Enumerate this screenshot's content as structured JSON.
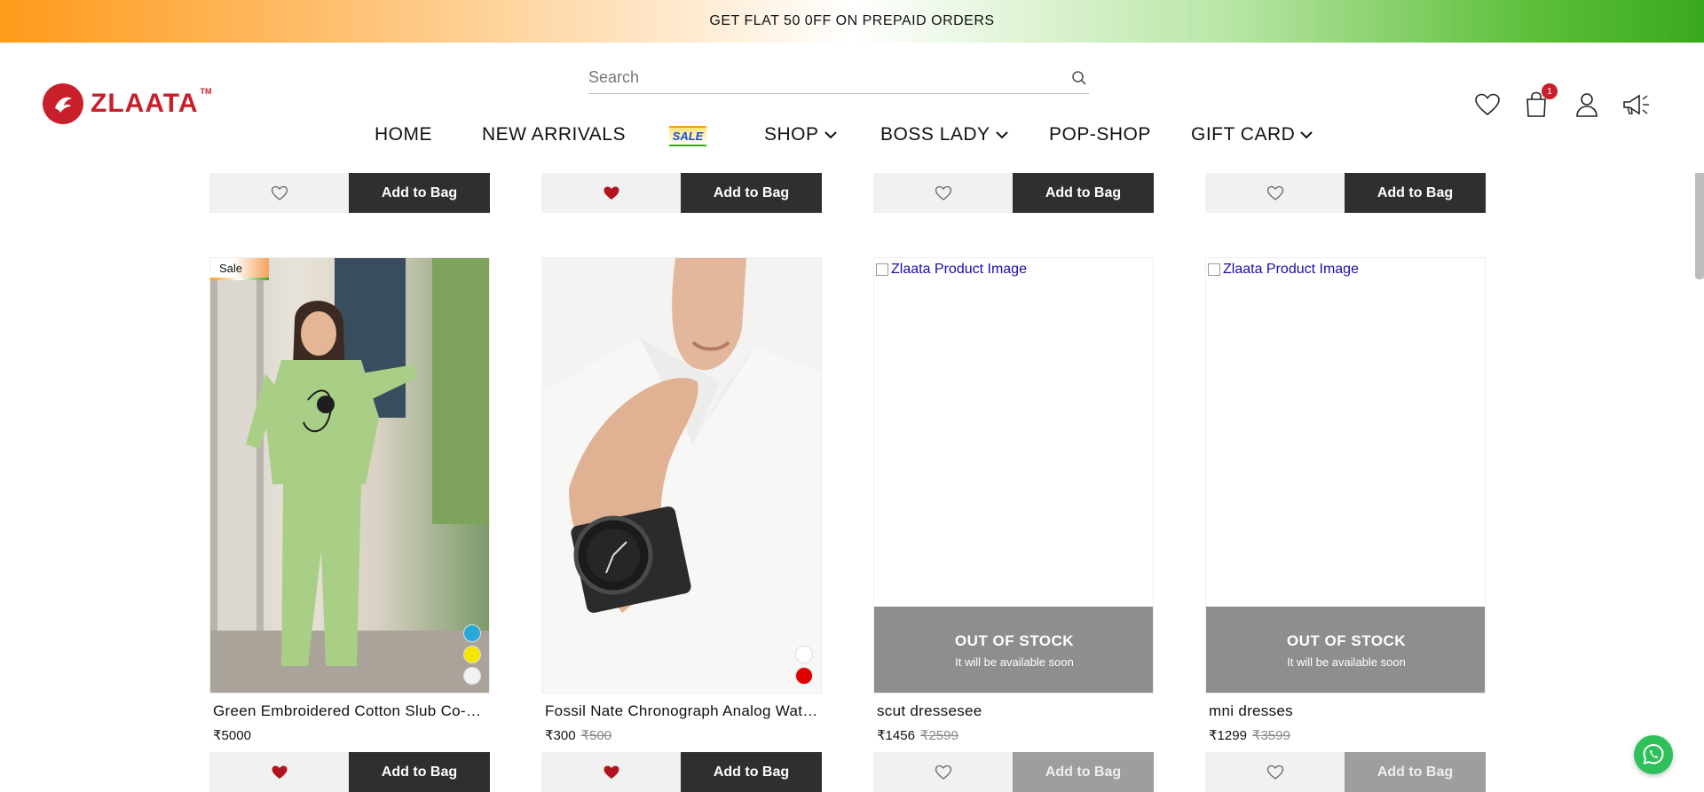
{
  "promo": {
    "text": "GET FLAT 50 0FF ON PREPAID ORDERS"
  },
  "brand": {
    "name": "ZLAATA",
    "tm": "TM",
    "color": "#c8202a"
  },
  "search": {
    "placeholder": "Search"
  },
  "nav": {
    "items": [
      {
        "label": "HOME"
      },
      {
        "label": "NEW ARRIVALS"
      },
      {
        "label": "SALE"
      },
      {
        "label": "SHOP",
        "dropdown": true
      },
      {
        "label": "BOSS LADY",
        "dropdown": true
      },
      {
        "label": "POP-SHOP"
      },
      {
        "label": "GIFT CARD",
        "dropdown": true
      }
    ]
  },
  "header_icons": {
    "cart_count": "1"
  },
  "top_row": {
    "add_to_bag": "Add to Bag",
    "wishlisted": [
      false,
      true,
      false,
      false
    ]
  },
  "products": [
    {
      "name": "Green Embroidered Cotton Slub Co-ord Set",
      "price": "₹5000",
      "old_price": "",
      "sale_tag": "Sale",
      "wishlisted": true,
      "out_of_stock": false,
      "swatches": [
        "#2aa8d8",
        "#f5e600",
        "#f1f1f1"
      ],
      "add_to_bag": "Add to Bag"
    },
    {
      "name": "Fossil Nate Chronograph Analog Watch",
      "price": "₹300",
      "old_price": "₹500",
      "sale_tag": "",
      "wishlisted": true,
      "out_of_stock": false,
      "swatches": [
        "#ffffff",
        "#e00000"
      ],
      "add_to_bag": "Add to Bag"
    },
    {
      "name": "scut dressesee",
      "price": "₹1456",
      "old_price": "₹2599",
      "sale_tag": "",
      "wishlisted": false,
      "out_of_stock": true,
      "image_alt": "Zlaata Product Image",
      "oos_title": "OUT OF STOCK",
      "oos_sub": "It will be available soon",
      "add_to_bag": "Add to Bag"
    },
    {
      "name": "mni dresses",
      "price": "₹1299",
      "old_price": "₹3599",
      "sale_tag": "",
      "wishlisted": false,
      "out_of_stock": true,
      "image_alt": "Zlaata Product Image",
      "oos_title": "OUT OF STOCK",
      "oos_sub": "It will be available soon",
      "add_to_bag": "Add to Bag"
    }
  ],
  "colors": {
    "accent": "#c8202a",
    "button_dark": "#2f2f2f",
    "oos_gray": "#8e8e8e",
    "whatsapp": "#2ec05a"
  }
}
